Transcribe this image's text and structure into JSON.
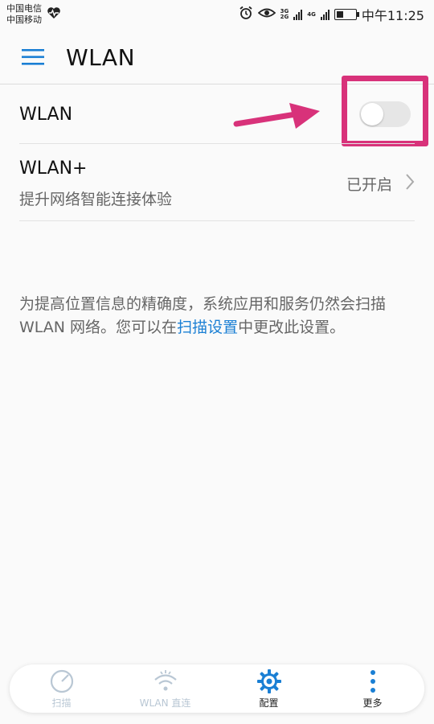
{
  "status_bar": {
    "carrier_1": "中国电信",
    "carrier_2": "中国移动",
    "net_top": "3G",
    "net_bottom": "2G",
    "net2_top": "4G",
    "net2_bottom": "",
    "battery_level": 0.35,
    "time": "中午11:25"
  },
  "app_bar": {
    "title": "WLAN"
  },
  "wlan_row": {
    "label": "WLAN",
    "toggle_on": false
  },
  "wlan_plus_row": {
    "title": "WLAN+",
    "subtitle": "提升网络智能连接体验",
    "status": "已开启"
  },
  "info": {
    "text_before": "为提高位置信息的精确度，系统应用和服务仍然会扫描 WLAN 网络。您可以在",
    "link": "扫描设置",
    "text_after": "中更改此设置。"
  },
  "bottom_nav": {
    "items": [
      {
        "label": "扫描",
        "icon": "scan-icon",
        "active": false
      },
      {
        "label": "WLAN 直连",
        "icon": "wifi-direct-icon",
        "active": false
      },
      {
        "label": "配置",
        "icon": "gear-icon",
        "active": true
      },
      {
        "label": "更多",
        "icon": "more-vertical-icon",
        "active": false
      }
    ]
  },
  "colors": {
    "accent": "#1a7fd4",
    "highlight": "#d8327a",
    "toggle_off": "#e6e6e6"
  }
}
